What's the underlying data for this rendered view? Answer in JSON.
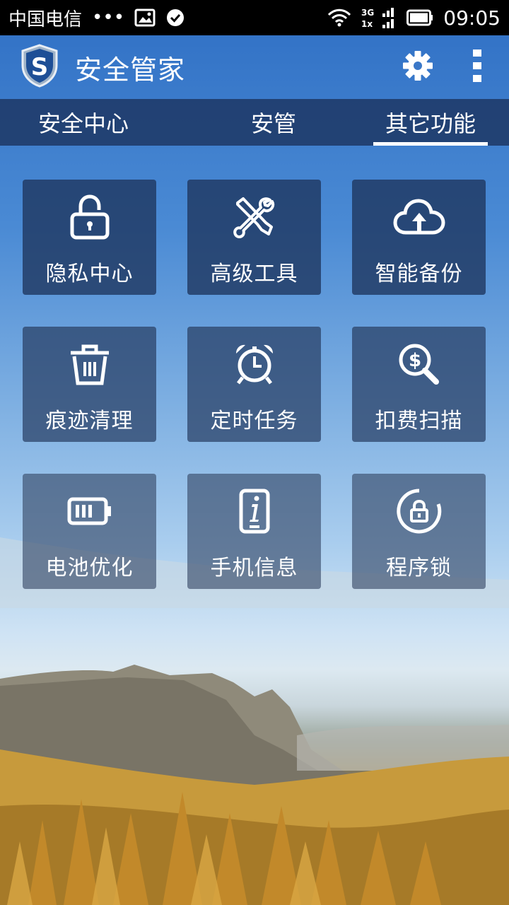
{
  "status_bar": {
    "carrier": "中国电信",
    "dots": "•••",
    "time": "09:05",
    "network_top": "3G",
    "network_bottom": "1x"
  },
  "app_bar": {
    "title": "安全管家",
    "logo_letter": "S"
  },
  "tabs": [
    {
      "label": "安全中心",
      "active": false
    },
    {
      "label": "安管",
      "active": false
    },
    {
      "label": "其它功能",
      "active": true
    }
  ],
  "tiles": [
    {
      "label": "隐私中心",
      "icon": "lock-icon"
    },
    {
      "label": "高级工具",
      "icon": "tools-icon"
    },
    {
      "label": "智能备份",
      "icon": "cloud-upload-icon"
    },
    {
      "label": "痕迹清理",
      "icon": "trash-icon"
    },
    {
      "label": "定时任务",
      "icon": "alarm-clock-icon"
    },
    {
      "label": "扣费扫描",
      "icon": "dollar-search-icon"
    },
    {
      "label": "电池优化",
      "icon": "battery-icon"
    },
    {
      "label": "手机信息",
      "icon": "phone-info-icon"
    },
    {
      "label": "程序锁",
      "icon": "circle-lock-icon"
    }
  ]
}
